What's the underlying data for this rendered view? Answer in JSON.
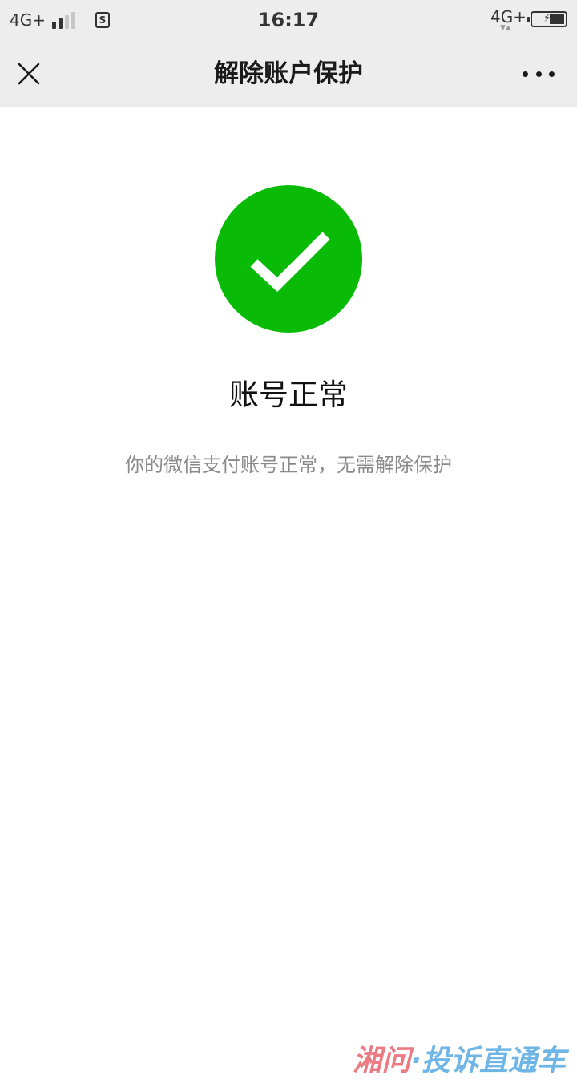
{
  "status_bar": {
    "network_left": "4G+",
    "sim_label": "S",
    "time": "16:17",
    "network_right": "4G+",
    "network_arrows": "▼▲",
    "battery_bolt": "⚡"
  },
  "nav": {
    "title": "解除账户保护"
  },
  "result": {
    "title": "账号正常",
    "description": "你的微信支付账号正常，无需解除保护",
    "success_color": "#09bb07"
  },
  "watermark": {
    "part1": "湘问",
    "part2": "·投诉直通车"
  }
}
